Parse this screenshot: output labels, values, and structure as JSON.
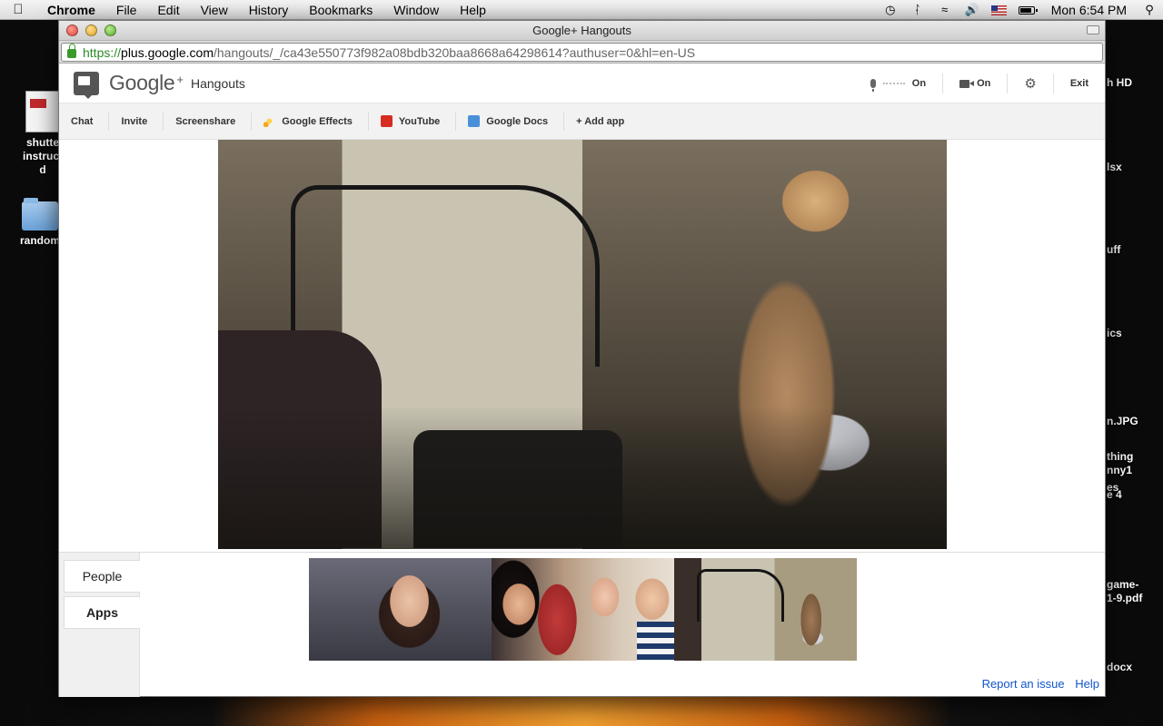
{
  "menubar": {
    "app_name": "Chrome",
    "items": [
      "File",
      "Edit",
      "View",
      "History",
      "Bookmarks",
      "Window",
      "Help"
    ],
    "clock": "Mon 6:54 PM"
  },
  "desktop": {
    "left_icons": [
      {
        "label": "shutte\ninstruct\nd",
        "kind": "document"
      },
      {
        "label": "random",
        "kind": "folder"
      }
    ],
    "right_labels": [
      "h HD",
      "lsx",
      "uff",
      "ics",
      "n.JPG",
      "thing",
      "nny1",
      "es",
      "e 4",
      "game-",
      "1-9.pdf",
      "docx"
    ]
  },
  "window": {
    "title": "Google+ Hangouts",
    "url": {
      "scheme": "https://",
      "host": "plus.google.com",
      "path": "/hangouts/_/ca43e550773f982a08bdb320baa8668a64298614?authuser=0&hl=en-US"
    }
  },
  "header": {
    "brand": "Google",
    "brand_plus": "+",
    "product": "Hangouts",
    "mic_state": "On",
    "camera_state": "On",
    "exit_label": "Exit"
  },
  "toolbar": {
    "chat": "Chat",
    "invite": "Invite",
    "screenshare": "Screenshare",
    "effects": "Google Effects",
    "youtube": "YouTube",
    "docs": "Google Docs",
    "add_app": "+ Add app"
  },
  "sidebar": {
    "people_tab": "People",
    "apps_tab": "Apps"
  },
  "footer": {
    "report": "Report an issue",
    "help": "Help"
  }
}
